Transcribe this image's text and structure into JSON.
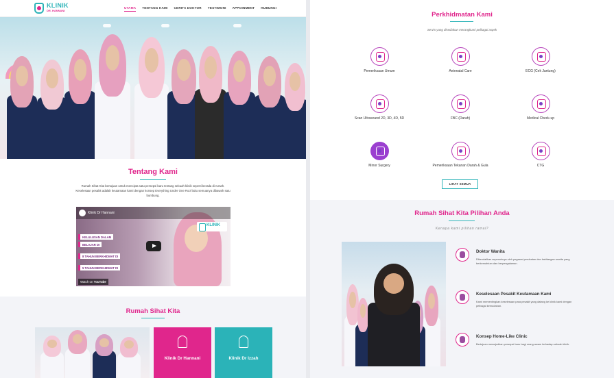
{
  "brand": {
    "name": "KLINIK",
    "sub": "DR. HANNANI",
    "accent": "#e0268c",
    "teal": "#2bb3b8"
  },
  "nav": {
    "items": [
      {
        "label": "UTAMA",
        "active": true
      },
      {
        "label": "TENTANG KAMI"
      },
      {
        "label": "CERITA DOKTOR"
      },
      {
        "label": "TESTIMONI"
      },
      {
        "label": "APPOINMENT"
      },
      {
        "label": "HUBUNGI"
      }
    ]
  },
  "tentang": {
    "title": "Tentang Kami",
    "text": "Rumah Sihat Kita bertujuan untuk mencipta satu persepsi baru tentang sebuah klinik seperti berada di rumah. Keselesaan pesakit adalah keutamaan kami dengan konsep Everything Under One Roof iaitu semuanya dibawah satu bumbung."
  },
  "video": {
    "title": "Klinik Dr Hannani",
    "watch": "Watch on",
    "platform": "YouTube",
    "logo": "KLINIK",
    "lines": [
      "KELULUSAN DALAM",
      "BELAJAR DI",
      "8 TAHUN BERKHIDMAT DI",
      "5 TAHUN BERKHIDMAT DI"
    ]
  },
  "rumah_sihat": {
    "title": "Rumah Sihat Kita",
    "cards": [
      {
        "label": "Klinik Dr Hannani",
        "color": "#e0268c"
      },
      {
        "label": "Klinik Dr Izzah",
        "color": "#2bb3b8"
      }
    ]
  },
  "perkhidmatan": {
    "title": "Perkhidmatan Kami",
    "subtitle": "Servis yang disediakan merangkumi pelbagai aspek",
    "services": [
      {
        "name": "Pemeriksaan Umum",
        "icon": "stethoscope-icon"
      },
      {
        "name": "Antenatal Care",
        "icon": "pregnancy-icon"
      },
      {
        "name": "ECG (Cek Jantung)",
        "icon": "ecg-monitor-icon"
      },
      {
        "name": "Scan Ultrasound 2D, 3D, 4D, 5D",
        "icon": "ultrasound-icon"
      },
      {
        "name": "FBC (Darah)",
        "icon": "blood-test-icon"
      },
      {
        "name": "Medical Check-up",
        "icon": "clipboard-heart-icon"
      },
      {
        "name": "Minor Surgery",
        "icon": "surgery-icon"
      },
      {
        "name": "Pemeriksaan Tekanan Darah & Gula",
        "icon": "blood-pressure-icon"
      },
      {
        "name": "CTG",
        "icon": "ctg-monitor-icon"
      }
    ],
    "button": "LIHAT SEMUA"
  },
  "pilihan": {
    "title": "Rumah Sihat Kita Pilihan Anda",
    "subtitle": "Kenapa kami pilihan ramai?",
    "features": [
      {
        "title": "Doktor Wanita",
        "desc": "Dikendalikan sepenuhnya oleh pegawai perubatan dan kakitangan wanita yang berkemahiran dan berpengalaman.",
        "icon": "female-doctor-icon"
      },
      {
        "title": "Keselesaan Pesakit Keutamaan Kami",
        "desc": "Kami mementingkan keselesaan para pesakit yang datang ke klinik kami dengan pelbagai kemudahan.",
        "icon": "patient-bed-icon"
      },
      {
        "title": "Konsep Home-Like Clinic",
        "desc": "Bertujuan mewujudkan persepsi baru bagi orang awam terhadap sebuah klinik.",
        "icon": "home-clinic-icon"
      }
    ]
  }
}
